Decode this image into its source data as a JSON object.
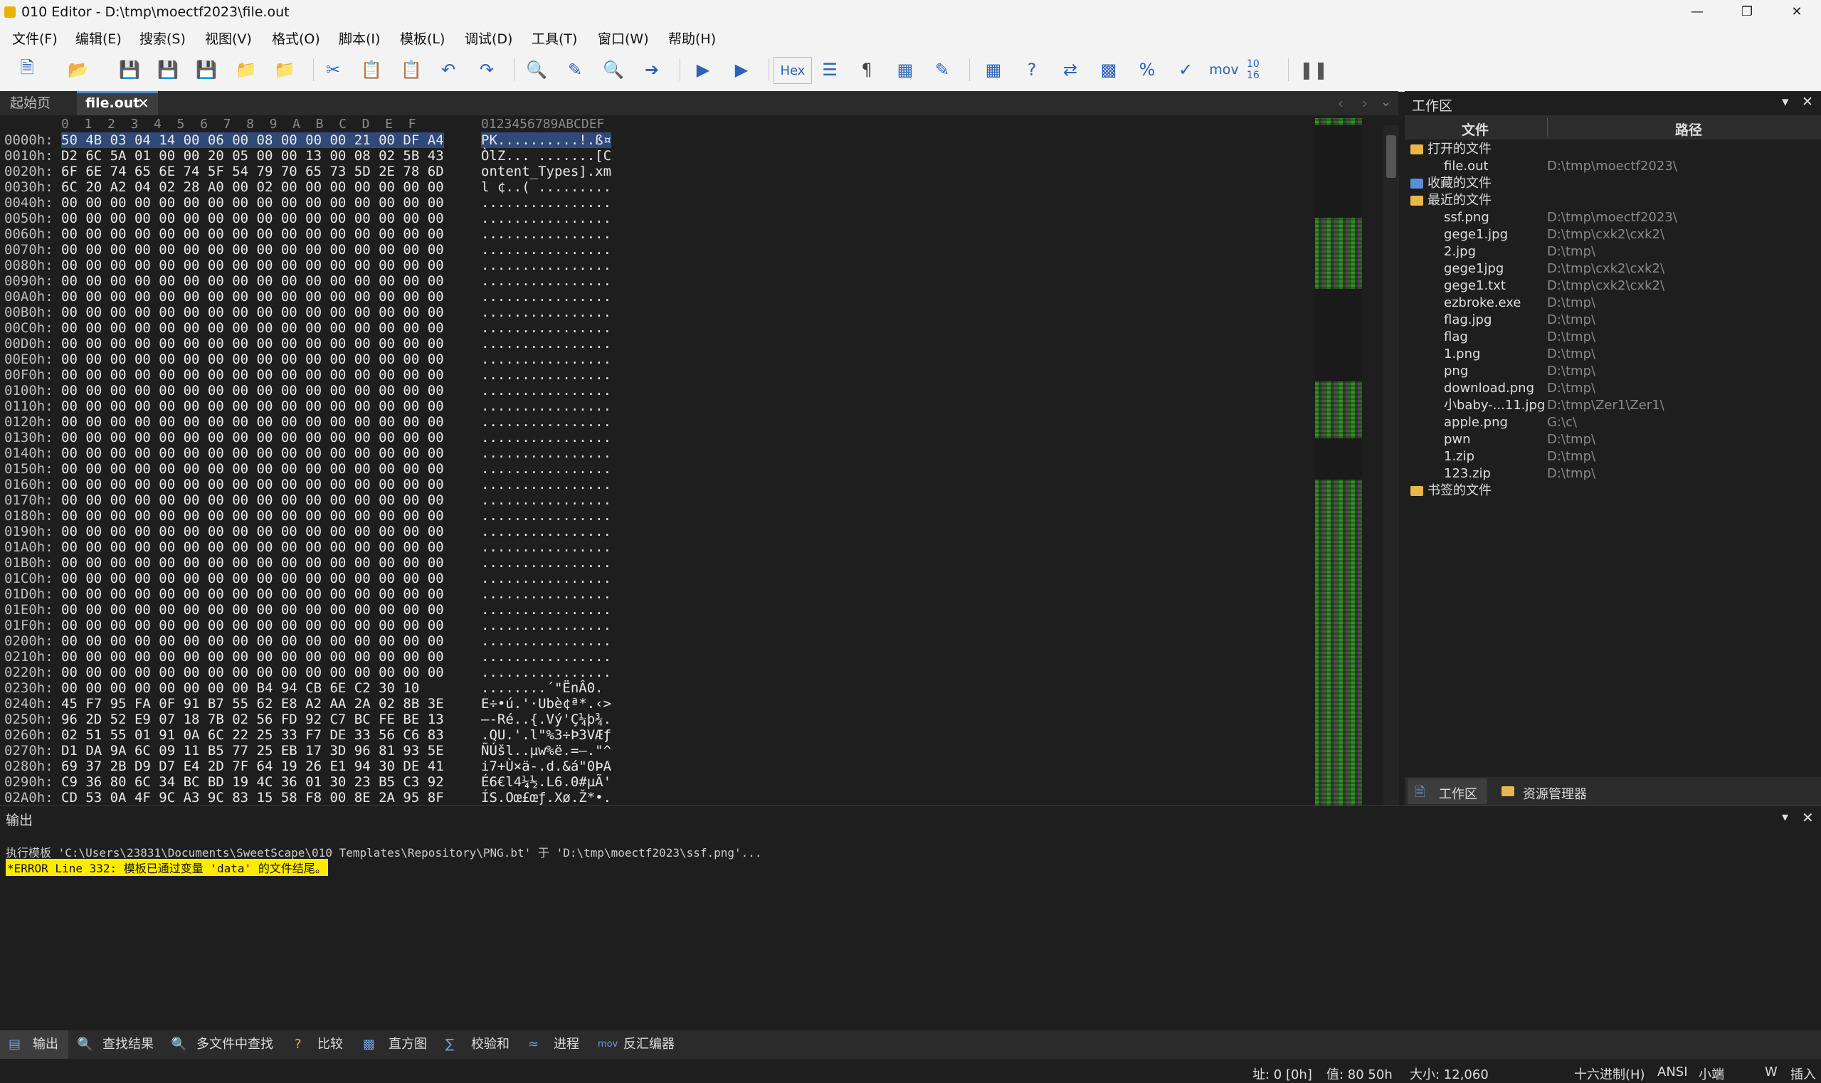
{
  "window": {
    "title": "010 Editor - D:\\tmp\\moectf2023\\file.out"
  },
  "menu": [
    "文件(F)",
    "编辑(E)",
    "搜索(S)",
    "视图(V)",
    "格式(O)",
    "脚本(I)",
    "模板(L)",
    "调试(D)",
    "工具(T)",
    "窗口(W)",
    "帮助(H)"
  ],
  "toolbar": {
    "hex_label": "Hex",
    "mov_label": "mov",
    "base_label": "10 16"
  },
  "tabs": {
    "start": "起始页",
    "file": "file.out"
  },
  "hex": {
    "col_header": "0  1  2  3  4  5  6  7  8  9  A  B  C  D  E  F",
    "ascii_header": "0123456789ABCDEF",
    "rows": [
      {
        "off": "0000h:",
        "hex": "50 4B 03 04 14 00 06 00 08 00 00 00 21 00 DF A4",
        "asc": "PK..........!.ß¤"
      },
      {
        "off": "0010h:",
        "hex": "D2 6C 5A 01 00 00 20 05 00 00 13 00 08 02 5B 43",
        "asc": "ÒlZ... .......[C"
      },
      {
        "off": "0020h:",
        "hex": "6F 6E 74 65 6E 74 5F 54 79 70 65 73 5D 2E 78 6D",
        "asc": "ontent_Types].xm"
      },
      {
        "off": "0030h:",
        "hex": "6C 20 A2 04 02 28 A0 00 02 00 00 00 00 00 00 00",
        "asc": "l ¢..( ........."
      },
      {
        "off": "0040h:",
        "hex": "00 00 00 00 00 00 00 00 00 00 00 00 00 00 00 00",
        "asc": "................"
      },
      {
        "off": "0050h:",
        "hex": "00 00 00 00 00 00 00 00 00 00 00 00 00 00 00 00",
        "asc": "................"
      },
      {
        "off": "0060h:",
        "hex": "00 00 00 00 00 00 00 00 00 00 00 00 00 00 00 00",
        "asc": "................"
      },
      {
        "off": "0070h:",
        "hex": "00 00 00 00 00 00 00 00 00 00 00 00 00 00 00 00",
        "asc": "................"
      },
      {
        "off": "0080h:",
        "hex": "00 00 00 00 00 00 00 00 00 00 00 00 00 00 00 00",
        "asc": "................"
      },
      {
        "off": "0090h:",
        "hex": "00 00 00 00 00 00 00 00 00 00 00 00 00 00 00 00",
        "asc": "................"
      },
      {
        "off": "00A0h:",
        "hex": "00 00 00 00 00 00 00 00 00 00 00 00 00 00 00 00",
        "asc": "................"
      },
      {
        "off": "00B0h:",
        "hex": "00 00 00 00 00 00 00 00 00 00 00 00 00 00 00 00",
        "asc": "................"
      },
      {
        "off": "00C0h:",
        "hex": "00 00 00 00 00 00 00 00 00 00 00 00 00 00 00 00",
        "asc": "................"
      },
      {
        "off": "00D0h:",
        "hex": "00 00 00 00 00 00 00 00 00 00 00 00 00 00 00 00",
        "asc": "................"
      },
      {
        "off": "00E0h:",
        "hex": "00 00 00 00 00 00 00 00 00 00 00 00 00 00 00 00",
        "asc": "................"
      },
      {
        "off": "00F0h:",
        "hex": "00 00 00 00 00 00 00 00 00 00 00 00 00 00 00 00",
        "asc": "................"
      },
      {
        "off": "0100h:",
        "hex": "00 00 00 00 00 00 00 00 00 00 00 00 00 00 00 00",
        "asc": "................"
      },
      {
        "off": "0110h:",
        "hex": "00 00 00 00 00 00 00 00 00 00 00 00 00 00 00 00",
        "asc": "................"
      },
      {
        "off": "0120h:",
        "hex": "00 00 00 00 00 00 00 00 00 00 00 00 00 00 00 00",
        "asc": "................"
      },
      {
        "off": "0130h:",
        "hex": "00 00 00 00 00 00 00 00 00 00 00 00 00 00 00 00",
        "asc": "................"
      },
      {
        "off": "0140h:",
        "hex": "00 00 00 00 00 00 00 00 00 00 00 00 00 00 00 00",
        "asc": "................"
      },
      {
        "off": "0150h:",
        "hex": "00 00 00 00 00 00 00 00 00 00 00 00 00 00 00 00",
        "asc": "................"
      },
      {
        "off": "0160h:",
        "hex": "00 00 00 00 00 00 00 00 00 00 00 00 00 00 00 00",
        "asc": "................"
      },
      {
        "off": "0170h:",
        "hex": "00 00 00 00 00 00 00 00 00 00 00 00 00 00 00 00",
        "asc": "................"
      },
      {
        "off": "0180h:",
        "hex": "00 00 00 00 00 00 00 00 00 00 00 00 00 00 00 00",
        "asc": "................"
      },
      {
        "off": "0190h:",
        "hex": "00 00 00 00 00 00 00 00 00 00 00 00 00 00 00 00",
        "asc": "................"
      },
      {
        "off": "01A0h:",
        "hex": "00 00 00 00 00 00 00 00 00 00 00 00 00 00 00 00",
        "asc": "................"
      },
      {
        "off": "01B0h:",
        "hex": "00 00 00 00 00 00 00 00 00 00 00 00 00 00 00 00",
        "asc": "................"
      },
      {
        "off": "01C0h:",
        "hex": "00 00 00 00 00 00 00 00 00 00 00 00 00 00 00 00",
        "asc": "................"
      },
      {
        "off": "01D0h:",
        "hex": "00 00 00 00 00 00 00 00 00 00 00 00 00 00 00 00",
        "asc": "................"
      },
      {
        "off": "01E0h:",
        "hex": "00 00 00 00 00 00 00 00 00 00 00 00 00 00 00 00",
        "asc": "................"
      },
      {
        "off": "01F0h:",
        "hex": "00 00 00 00 00 00 00 00 00 00 00 00 00 00 00 00",
        "asc": "................"
      },
      {
        "off": "0200h:",
        "hex": "00 00 00 00 00 00 00 00 00 00 00 00 00 00 00 00",
        "asc": "................"
      },
      {
        "off": "0210h:",
        "hex": "00 00 00 00 00 00 00 00 00 00 00 00 00 00 00 00",
        "asc": "................"
      },
      {
        "off": "0220h:",
        "hex": "00 00 00 00 00 00 00 00 00 00 00 00 00 00 00 00",
        "asc": "................"
      },
      {
        "off": "0230h:",
        "hex": "00 00 00 00 00 00 00 00 B4 94 CB 6E C2 30 10",
        "asc": "........´\"ËnÂ0."
      },
      {
        "off": "0240h:",
        "hex": "45 F7 95 FA 0F 91 B7 55 62 E8 A2 AA 2A 02 8B 3E",
        "asc": "E÷•ú.'·Ubè¢ª*.‹>"
      },
      {
        "off": "0250h:",
        "hex": "96 2D 52 E9 07 18 7B 02 56 FD 92 C7 BC FE BE 13",
        "asc": "–-Ré..{.Vý'Ç¼þ¾."
      },
      {
        "off": "0260h:",
        "hex": "02 51 55 01 91 0A 6C 22 25 33 F7 DE 33 56 C6 83",
        "asc": ".QU.'.l\"%3÷Þ3VÆƒ"
      },
      {
        "off": "0270h:",
        "hex": "D1 DA 9A 6C 09 11 B5 77 25 EB 17 3D 96 81 93 5E",
        "asc": "ÑÚšl..µw%ë.=–.\"^"
      },
      {
        "off": "0280h:",
        "hex": "69 37 2B D9 D7 E4 2D 7F 64 19 26 E1 94 30 DE 41",
        "asc": "i7+Ù×ä-.d.&á\"0ÞA"
      },
      {
        "off": "0290h:",
        "hex": "C9 36 80 6C 34 BC BD 19 4C 36 01 30 23 B5 C3 92",
        "asc": "É6€l4¼½.L6.0#µÃ'"
      },
      {
        "off": "02A0h:",
        "hex": "CD 53 0A 4F 9C A3 9C 83 15 58 F8 00 8E 2A 95 8F",
        "asc": "ÍS.Oœ£œƒ.Xø.Ž*•."
      }
    ]
  },
  "workspace": {
    "title": "工作区",
    "col_file": "文件",
    "col_path": "路径",
    "open_files": "打开的文件",
    "favorites": "收藏的文件",
    "recent": "最近的文件",
    "bookmarks": "书签的文件",
    "open_list": [
      {
        "name": "file.out",
        "path": "D:\\tmp\\moectf2023\\"
      }
    ],
    "recent_list": [
      {
        "name": "ssf.png",
        "path": "D:\\tmp\\moectf2023\\"
      },
      {
        "name": "gege1.jpg",
        "path": "D:\\tmp\\cxk2\\cxk2\\"
      },
      {
        "name": "2.jpg",
        "path": "D:\\tmp\\"
      },
      {
        "name": "gege1jpg",
        "path": "D:\\tmp\\cxk2\\cxk2\\"
      },
      {
        "name": "gege1.txt",
        "path": "D:\\tmp\\cxk2\\cxk2\\"
      },
      {
        "name": "ezbroke.exe",
        "path": "D:\\tmp\\"
      },
      {
        "name": "flag.jpg",
        "path": "D:\\tmp\\"
      },
      {
        "name": "flag",
        "path": "D:\\tmp\\"
      },
      {
        "name": "1.png",
        "path": "D:\\tmp\\"
      },
      {
        "name": "png",
        "path": "D:\\tmp\\"
      },
      {
        "name": "download.png",
        "path": "D:\\tmp\\"
      },
      {
        "name": "小baby-...11.jpg",
        "path": "D:\\tmp\\Zer1\\Zer1\\"
      },
      {
        "name": "apple.png",
        "path": "G:\\c\\"
      },
      {
        "name": "pwn",
        "path": "D:\\tmp\\"
      },
      {
        "name": "1.zip",
        "path": "D:\\tmp\\"
      },
      {
        "name": "123.zip",
        "path": "D:\\tmp\\"
      }
    ],
    "tab_workspace": "工作区",
    "tab_explorer": "资源管理器"
  },
  "output": {
    "title": "输出",
    "line1": "执行模板 'C:\\Users\\23831\\Documents\\SweetScape\\010 Templates\\Repository\\PNG.bt' 于 'D:\\tmp\\moectf2023\\ssf.png'...",
    "error": "*ERROR Line 332: 模板已通过变量 'data' 的文件结尾。"
  },
  "output_tabs": [
    "输出",
    "查找结果",
    "多文件中查找",
    "比较",
    "直方图",
    "校验和",
    "进程",
    "反汇编器"
  ],
  "status": {
    "addr": "址: 0 [0h]",
    "value": "值: 80 50h",
    "size": "大小: 12,060",
    "mode": "十六进制(H)",
    "encoding": "ANSI",
    "endian": "小端",
    "w": "W",
    "insert": "插入"
  }
}
